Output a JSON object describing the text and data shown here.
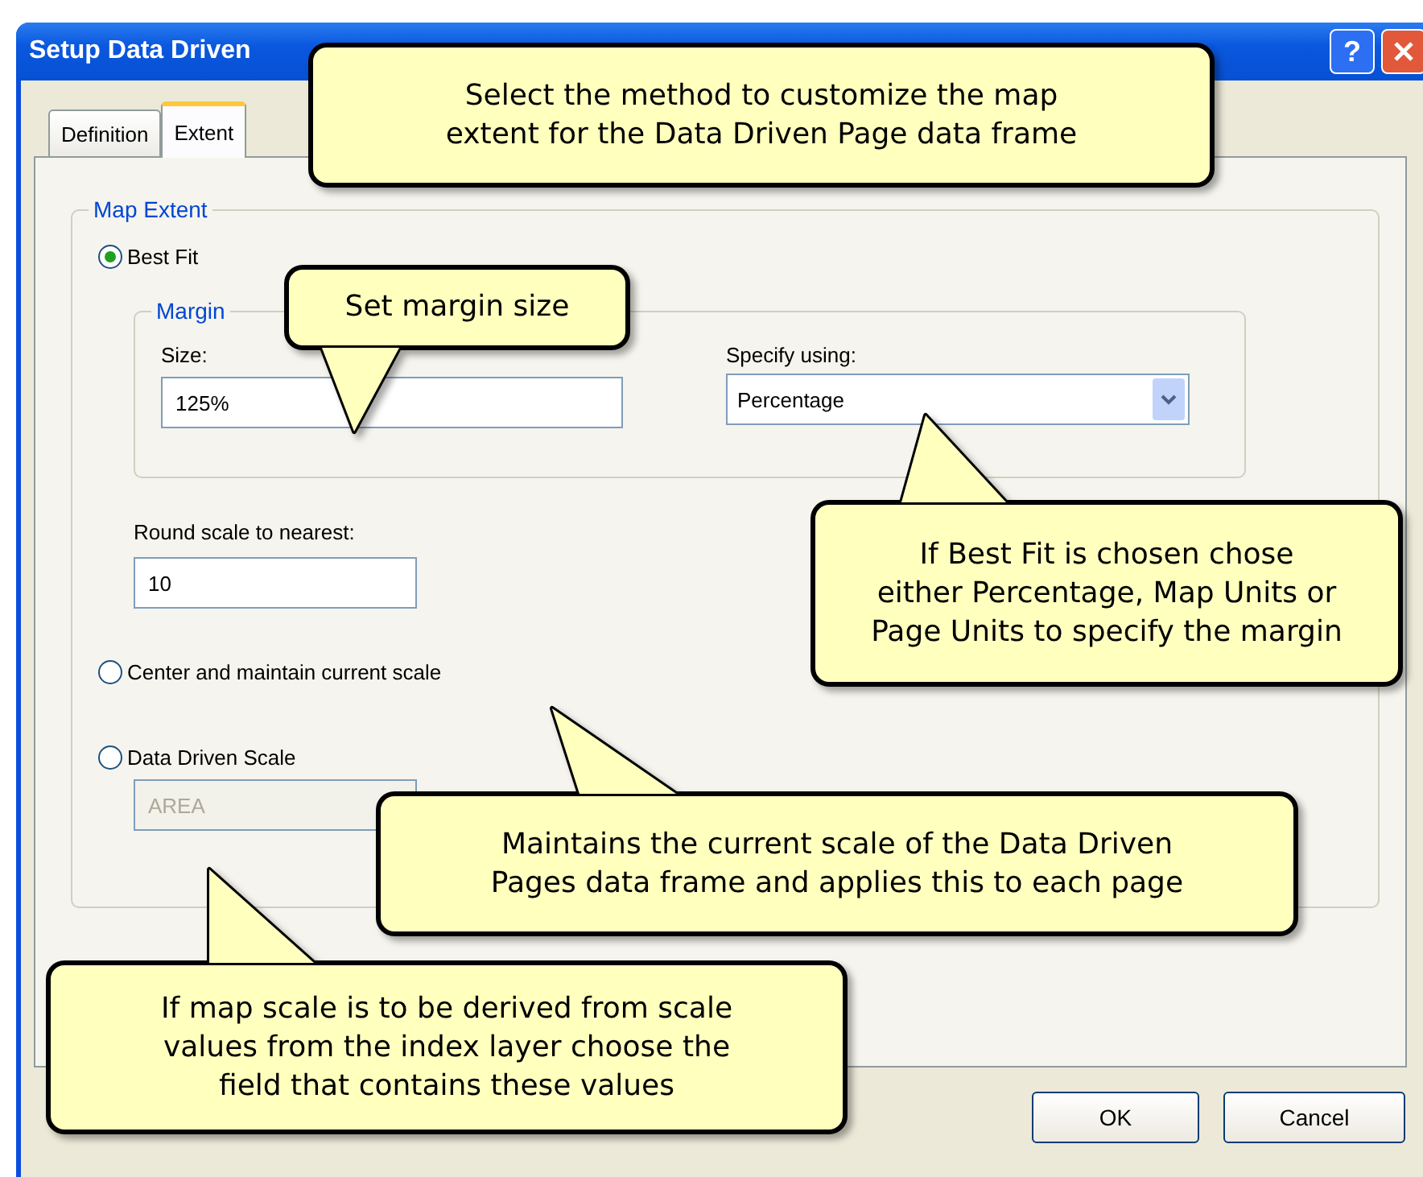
{
  "window": {
    "title": "Setup Data Driven",
    "help": "?"
  },
  "tabs": [
    {
      "label": "Definition",
      "selected": false
    },
    {
      "label": "Extent",
      "selected": true
    }
  ],
  "map_extent": {
    "legend": "Map Extent",
    "options": [
      {
        "label": "Best Fit",
        "selected": true
      },
      {
        "label": "Center and maintain current scale",
        "selected": false
      },
      {
        "label": "Data Driven Scale",
        "selected": false
      }
    ],
    "margin": {
      "legend": "Margin",
      "size_label": "Size:",
      "size_value": "125%",
      "specify_label": "Specify using:",
      "specify_value": "Percentage"
    },
    "round_label": "Round scale to nearest:",
    "round_value": "10",
    "scale_field": {
      "value": "AREA",
      "disabled": true
    }
  },
  "buttons": [
    "OK",
    "Cancel"
  ],
  "callouts": [
    {
      "text": "Select the method to customize the map\nextent for the Data Driven Page data frame"
    },
    {
      "text": "Set margin size"
    },
    {
      "text": "If Best Fit is chosen chose\neither Percentage, Map Units or\nPage Units to specify the margin"
    },
    {
      "text": "Maintains the current scale of the Data Driven\nPages data frame and applies this to each page"
    },
    {
      "text": "If map scale is to be derived from scale\nvalues from the index layer choose the\nfield that contains these values"
    }
  ]
}
